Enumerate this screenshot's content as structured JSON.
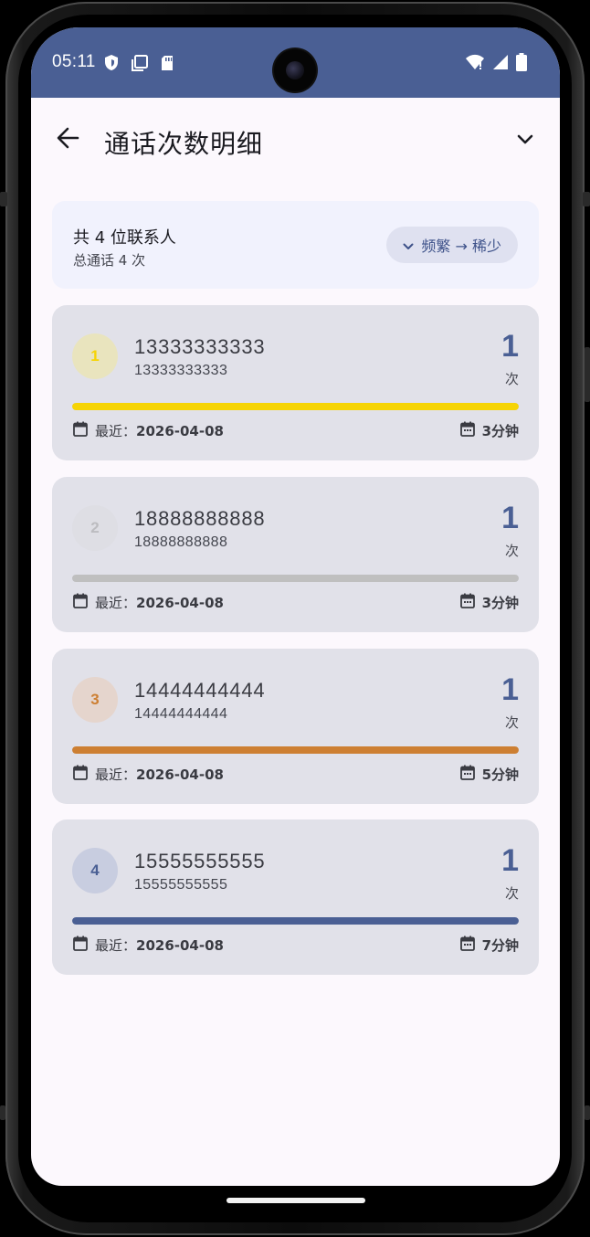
{
  "status_bar": {
    "time": "05:11",
    "left_icons": [
      "shield-icon",
      "screenshot-icon",
      "sd-card-icon"
    ],
    "right_icons": [
      "wifi-icon",
      "signal-icon",
      "battery-icon"
    ],
    "background": "#4a5f94"
  },
  "app_bar": {
    "title": "通话次数明细",
    "back_icon": "arrow-back-icon",
    "menu_icon": "chevron-down-icon"
  },
  "summary": {
    "contacts": "共 4 位联系人",
    "total_calls": "总通话 4 次",
    "sort_label": "频繁 → 稀少",
    "sort_icon": "chevron-down-icon"
  },
  "contacts": [
    {
      "rank": "1",
      "name": "13333333333",
      "phone": "13333333333",
      "count": "1",
      "unit": "次",
      "recent_label": "最近：",
      "recent_date": "2026-04-08",
      "duration": "3分钟",
      "bar_fraction": 1.0,
      "accent": "#f6d405",
      "badge_bg": "#e9e4be"
    },
    {
      "rank": "2",
      "name": "18888888888",
      "phone": "18888888888",
      "count": "1",
      "unit": "次",
      "recent_label": "最近：",
      "recent_date": "2026-04-08",
      "duration": "3分钟",
      "bar_fraction": 1.0,
      "accent": "#bfbfbf",
      "badge_bg": "#dedee4",
      "badge_fg": "#bcbcc0"
    },
    {
      "rank": "3",
      "name": "14444444444",
      "phone": "14444444444",
      "count": "1",
      "unit": "次",
      "recent_label": "最近：",
      "recent_date": "2026-04-08",
      "duration": "5分钟",
      "bar_fraction": 1.0,
      "accent": "#cd7f32",
      "badge_bg": "#e5d5cd"
    },
    {
      "rank": "4",
      "name": "15555555555",
      "phone": "15555555555",
      "count": "1",
      "unit": "次",
      "recent_label": "最近：",
      "recent_date": "2026-04-08",
      "duration": "7分钟",
      "bar_fraction": 1.0,
      "accent": "#4a5f94",
      "badge_bg": "#c8cde0"
    }
  ]
}
